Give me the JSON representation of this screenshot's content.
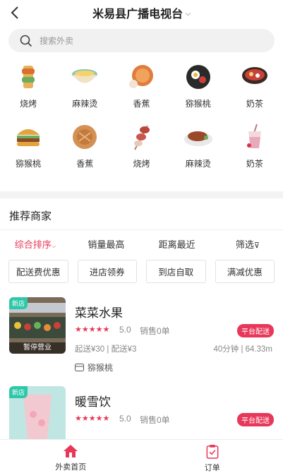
{
  "header": {
    "title": "米易县广播电视台",
    "caret": "⌵"
  },
  "search": {
    "placeholder": "搜索外卖"
  },
  "categories": [
    {
      "label": "烧烤",
      "icon": "bbq-skewer-icon",
      "color": "#d98b3a"
    },
    {
      "label": "麻辣烫",
      "icon": "noodle-bowl-icon",
      "color": "#6bae5c"
    },
    {
      "label": "香蕉",
      "icon": "pancake-icon",
      "color": "#d2703b"
    },
    {
      "label": "猕猴桃",
      "icon": "hotpot-icon",
      "color": "#333333"
    },
    {
      "label": "奶茶",
      "icon": "soup-bowl-icon",
      "color": "#c9413a"
    },
    {
      "label": "猕猴桃",
      "icon": "burger-icon",
      "color": "#d9962f"
    },
    {
      "label": "香蕉",
      "icon": "pie-icon",
      "color": "#c27a3d"
    },
    {
      "label": "烧烤",
      "icon": "meat-skewer-icon",
      "color": "#b8473e"
    },
    {
      "label": "麻辣烫",
      "icon": "steak-plate-icon",
      "color": "#9a4a2a"
    },
    {
      "label": "奶茶",
      "icon": "drink-cup-icon",
      "color": "#e6c5cf"
    }
  ],
  "section_title": "推荐商家",
  "sorts": [
    {
      "label": "综合排序",
      "suffix": "⌵",
      "active": true
    },
    {
      "label": "销量最高",
      "suffix": "",
      "active": false
    },
    {
      "label": "距离最近",
      "suffix": "",
      "active": false
    },
    {
      "label": "筛选",
      "suffix": "⊽",
      "active": false
    }
  ],
  "filters": [
    "配送费优惠",
    "进店领券",
    "到店自取",
    "满减优惠"
  ],
  "shops": [
    {
      "name": "菜菜水果",
      "new_tag": "新店",
      "status": "暂停营业",
      "stars": "★★★★★",
      "rating": "5.0",
      "sales": "销售0单",
      "badge": "平台配送",
      "delivery": "起送¥30 | 配送¥3",
      "eta": "40分钟 | 64.33m",
      "tag": "猕猴桃"
    },
    {
      "name": "暖雪饮",
      "new_tag": "新店",
      "stars": "★★★★★",
      "rating": "5.0",
      "sales": "销售0单",
      "badge": "平台配送"
    }
  ],
  "tabbar": [
    {
      "label": "外卖首页",
      "icon": "home-icon",
      "active": true
    },
    {
      "label": "订单",
      "icon": "order-clipboard-icon",
      "active": false
    }
  ],
  "colors": {
    "accent": "#e8385a",
    "new_tag": "#2ec8a9"
  }
}
